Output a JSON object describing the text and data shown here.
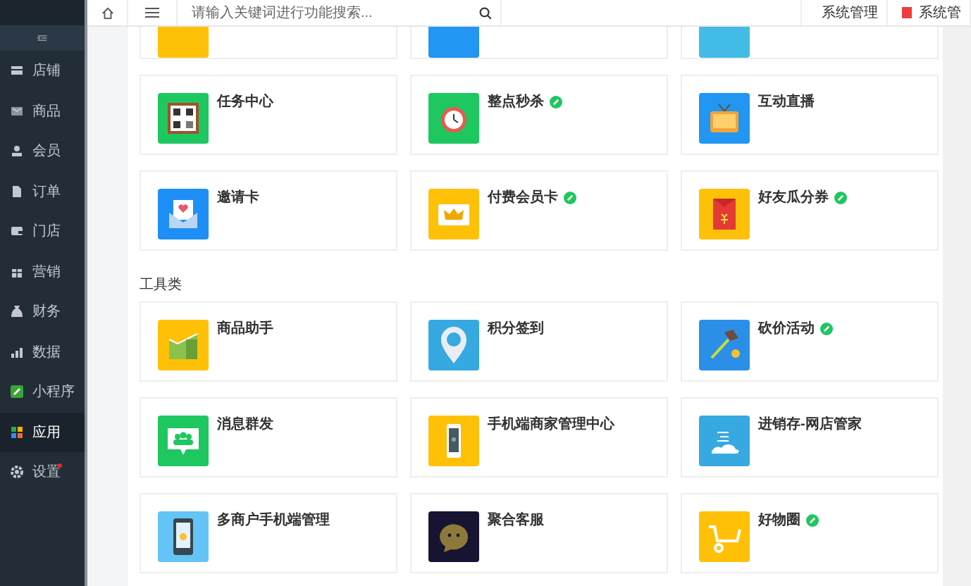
{
  "topbar": {
    "search": {
      "placeholder": "请输入关键词进行功能搜索..."
    },
    "buttons": [
      {
        "label": "系统管理",
        "kind": "plain"
      },
      {
        "label": "系统管",
        "kind": "flag"
      }
    ]
  },
  "sidebar": {
    "items": [
      {
        "label": "店铺",
        "selected": false,
        "dot": false
      },
      {
        "label": "商品",
        "selected": false,
        "dot": false
      },
      {
        "label": "会员",
        "selected": false,
        "dot": false
      },
      {
        "label": "订单",
        "selected": false,
        "dot": false
      },
      {
        "label": "门店",
        "selected": false,
        "dot": false
      },
      {
        "label": "营销",
        "selected": false,
        "dot": false
      },
      {
        "label": "财务",
        "selected": false,
        "dot": false
      },
      {
        "label": "数据",
        "selected": false,
        "dot": false
      },
      {
        "label": "小程序",
        "selected": false,
        "dot": false
      },
      {
        "label": "应用",
        "selected": true,
        "dot": false
      },
      {
        "label": "设置",
        "selected": false,
        "dot": true
      }
    ]
  },
  "sections": [
    {
      "cards": [
        {
          "color": "#ffc107"
        },
        {
          "color": "#2196f3"
        },
        {
          "color": "#42bce6"
        },
        {
          "title": "任务中心",
          "color": "#1ec760",
          "linked": false
        },
        {
          "title": "整点秒杀",
          "color": "#1ec760",
          "linked": true
        },
        {
          "title": "互动直播",
          "color": "#2196f3",
          "linked": false
        },
        {
          "title": "邀请卡",
          "color": "#1e8ff7",
          "linked": false
        },
        {
          "title": "付费会员卡",
          "color": "#ffc107",
          "linked": true
        },
        {
          "title": "好友瓜分券",
          "color": "#ffc107",
          "linked": true
        }
      ]
    },
    {
      "title": "工具类",
      "cards": [
        {
          "title": "商品助手",
          "color": "#ffc107",
          "linked": false
        },
        {
          "title": "积分签到",
          "color": "#36a9e1",
          "linked": false
        },
        {
          "title": "砍价活动",
          "color": "#2b8fe8",
          "linked": true
        },
        {
          "title": "消息群发",
          "color": "#1ec760",
          "linked": false
        },
        {
          "title": "手机端商家管理中心",
          "color": "#ffc107",
          "linked": false
        },
        {
          "title": "进销存-网店管家",
          "color": "#36a9e1",
          "linked": false
        },
        {
          "title": "多商户手机端管理",
          "color": "#64c4f5",
          "linked": false
        },
        {
          "title": "聚合客服",
          "color": "#171432",
          "linked": false
        },
        {
          "title": "好物圈",
          "color": "#ffc107",
          "linked": true
        }
      ]
    }
  ]
}
